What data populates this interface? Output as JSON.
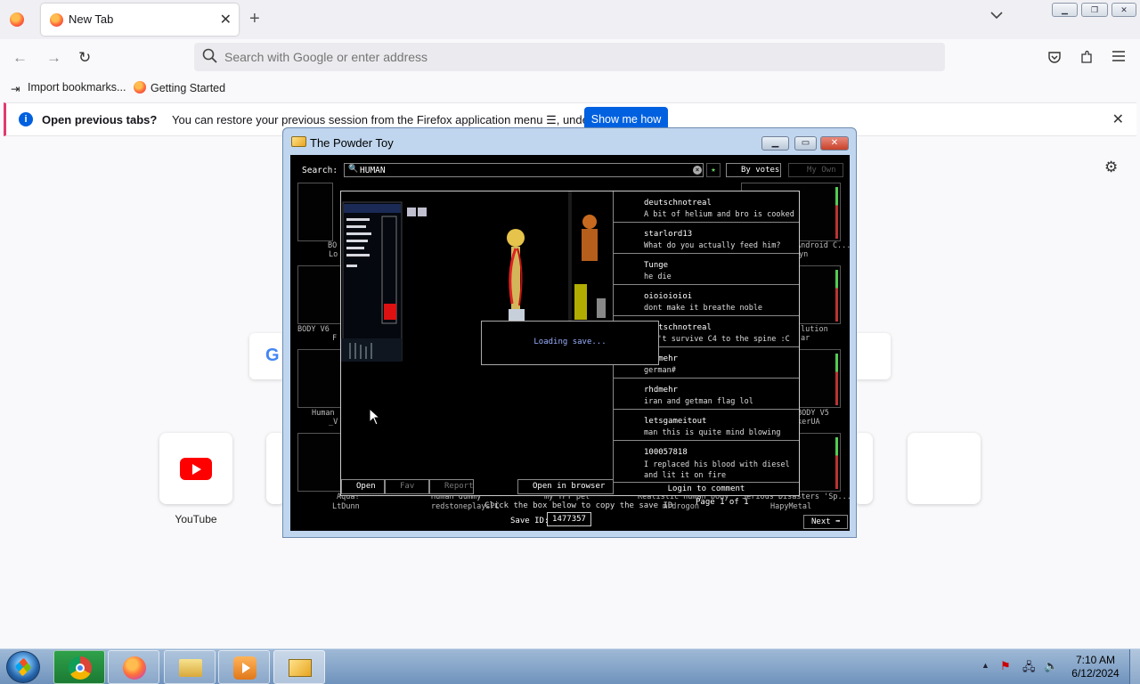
{
  "browser": {
    "tab_title": "New Tab",
    "new_tab_symbol": "+",
    "close_symbol": "✕",
    "url_placeholder": "Search with Google or enter address",
    "bookmarks": [
      "Import bookmarks...",
      "Getting Started"
    ]
  },
  "infobar": {
    "bold_text": "Open previous tabs?",
    "text": "You can restore your previous session from the Firefox application menu ☰, under History.",
    "button_label": "Show me how"
  },
  "newtab": {
    "tiles": [
      {
        "label": "YouTube",
        "icon": "youtube-icon"
      }
    ]
  },
  "tpt": {
    "window_title": "The Powder Toy",
    "search_label": "Search:",
    "search_query": "HUMAN",
    "sort_label": "By votes",
    "my_own_label": "My Own",
    "loading_text": "Loading save...",
    "thumbnails": [
      {
        "title": "BO",
        "author": "Lo"
      },
      {
        "title": "Android C...",
        "author": "yn"
      },
      {
        "title": "BODY V6",
        "author": "F"
      },
      {
        "title": "lution",
        "author": "ar"
      },
      {
        "title": "Human",
        "author": "_V"
      },
      {
        "title": "BODY V5",
        "author": "kerUA"
      },
      {
        "title": "Aqua!",
        "author": "LtDunn"
      },
      {
        "title": "Human dummy",
        "author": "redstoneplaysPC"
      },
      {
        "title": "my TPT pet",
        "author": ""
      },
      {
        "title": "Realistic human body",
        "author": "mrdrogon"
      },
      {
        "title": "Serious Disasters 'Sp...",
        "author": "HapyMetal"
      }
    ],
    "comments": [
      {
        "user": "deutschnotreal",
        "text": "A bit of helium and bro is cooked"
      },
      {
        "user": "starlord13",
        "text": "What do you actually feed him?"
      },
      {
        "user": "Tunge",
        "text": "he die"
      },
      {
        "user": "oioioioioi",
        "text": "dont make it breathe noble"
      },
      {
        "user": "deutschnotreal",
        "text": "can't survive C4 to the spine :C"
      },
      {
        "user": "rhdmehr",
        "text": "german#"
      },
      {
        "user": "rhdmehr",
        "text": "iran and getman flag lol"
      },
      {
        "user": "letsgameitout",
        "text": "man this is quite mind blowing"
      },
      {
        "user": "100057818",
        "text": "I replaced his blood with diesel and lit it on fire"
      }
    ],
    "buttons": {
      "open": "Open",
      "fav": "Fav",
      "report": "Report",
      "open_browser": "Open in browser",
      "login": "Login to comment"
    },
    "copy_hint": "Click the box below to copy the save ID",
    "page_info": "Page 1 of 1",
    "save_id_label": "Save ID:",
    "save_id": "1477357",
    "next_label": "Next"
  },
  "taskbar": {
    "time": "7:10 AM",
    "date": "6/12/2024"
  }
}
